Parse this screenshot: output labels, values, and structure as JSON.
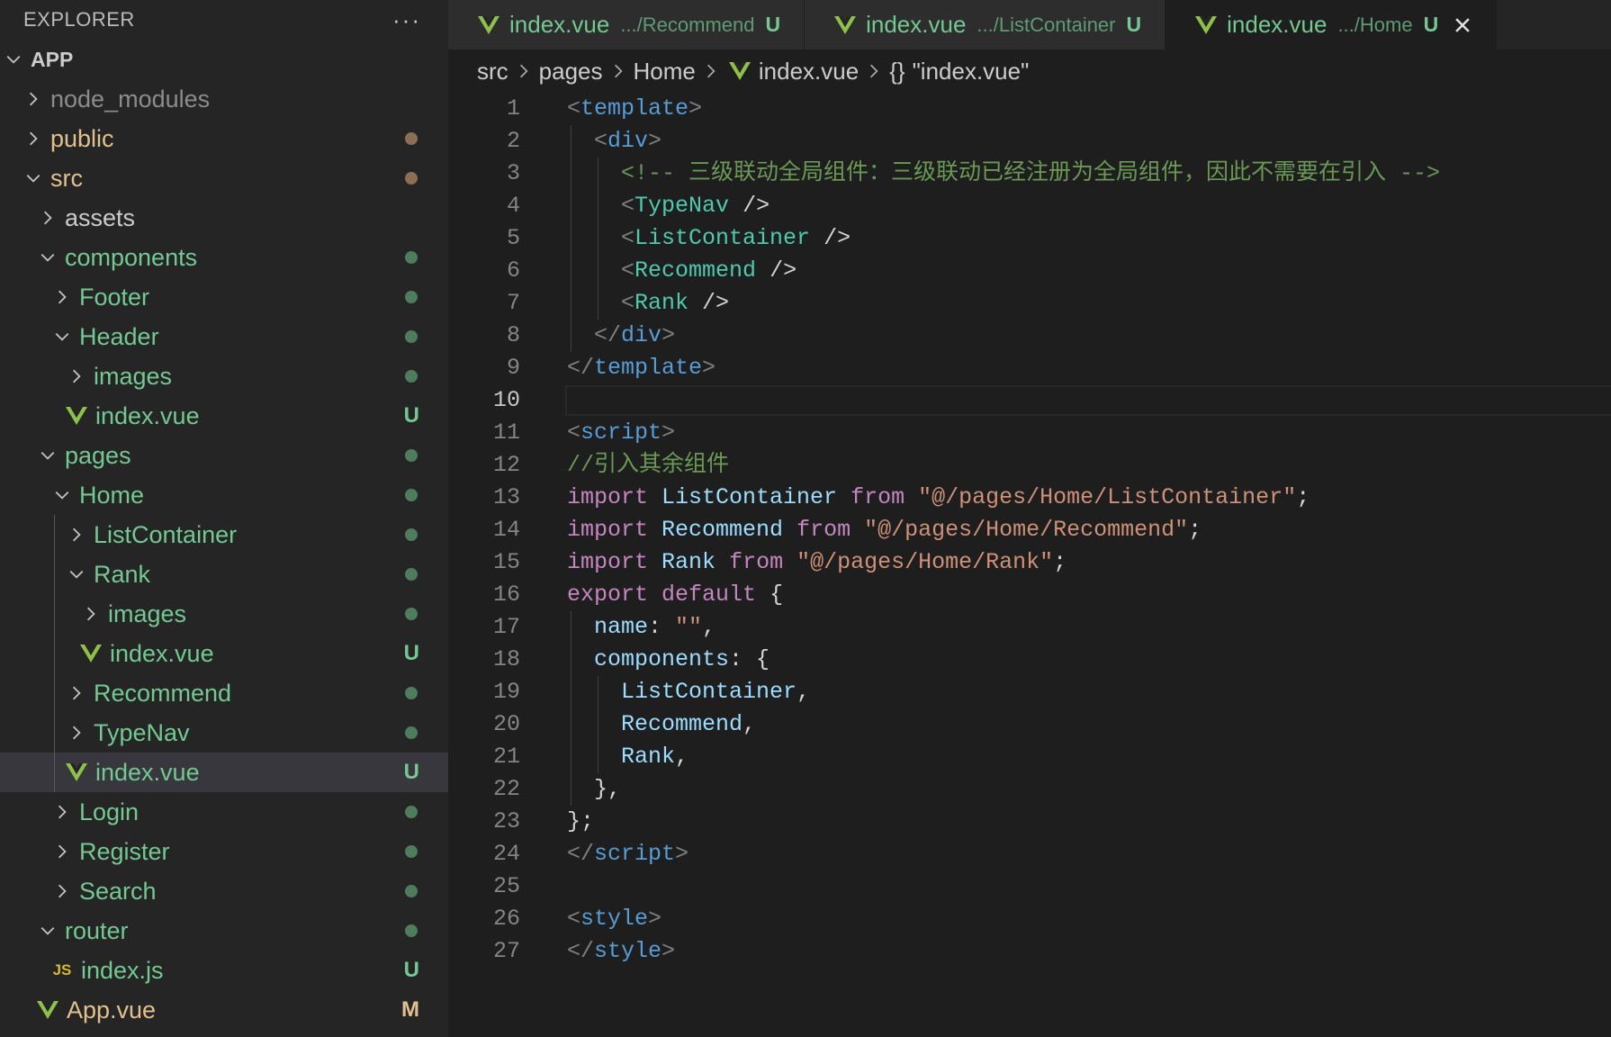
{
  "colors": {
    "untracked": "#73c991",
    "modified": "#e2c08d",
    "folder_untracked": "#73c991",
    "dot_brown": "#8a6f55",
    "vue_icon": "#8dc149"
  },
  "explorer": {
    "title": "EXPLORER",
    "more": "···",
    "tree": [
      {
        "label": "APP",
        "depth": 0,
        "type": "root",
        "expanded": true,
        "color": "#cccccc",
        "bold": true
      },
      {
        "label": "node_modules",
        "depth": 1,
        "type": "folder",
        "expanded": false,
        "color": "#8c8c8c"
      },
      {
        "label": "public",
        "depth": 1,
        "type": "folder",
        "expanded": false,
        "color": "#e2c08d",
        "dot": "#8a6f55"
      },
      {
        "label": "src",
        "depth": 1,
        "type": "folder",
        "expanded": true,
        "color": "#e2c08d",
        "dot": "#8a6f55"
      },
      {
        "label": "assets",
        "depth": 2,
        "type": "folder",
        "expanded": false,
        "color": "#cccccc"
      },
      {
        "label": "components",
        "depth": 2,
        "type": "folder",
        "expanded": true,
        "color": "#73c991",
        "dot": "#4e7d5c"
      },
      {
        "label": "Footer",
        "depth": 3,
        "type": "folder",
        "expanded": false,
        "color": "#73c991",
        "dot": "#4e7d5c"
      },
      {
        "label": "Header",
        "depth": 3,
        "type": "folder",
        "expanded": true,
        "color": "#73c991",
        "dot": "#4e7d5c"
      },
      {
        "label": "images",
        "depth": 4,
        "type": "folder",
        "expanded": false,
        "color": "#73c991",
        "dot": "#4e7d5c"
      },
      {
        "label": "index.vue",
        "depth": 4,
        "type": "vue",
        "color": "#73c991",
        "badge": "U"
      },
      {
        "label": "pages",
        "depth": 2,
        "type": "folder",
        "expanded": true,
        "color": "#73c991",
        "dot": "#4e7d5c"
      },
      {
        "label": "Home",
        "depth": 3,
        "type": "folder",
        "expanded": true,
        "color": "#73c991",
        "dot": "#4e7d5c"
      },
      {
        "label": "ListContainer",
        "depth": 4,
        "type": "folder",
        "expanded": false,
        "color": "#73c991",
        "dot": "#4e7d5c"
      },
      {
        "label": "Rank",
        "depth": 4,
        "type": "folder",
        "expanded": true,
        "color": "#73c991",
        "dot": "#4e7d5c"
      },
      {
        "label": "images",
        "depth": 5,
        "type": "folder",
        "expanded": false,
        "color": "#73c991",
        "dot": "#4e7d5c"
      },
      {
        "label": "index.vue",
        "depth": 5,
        "type": "vue",
        "color": "#73c991",
        "badge": "U"
      },
      {
        "label": "Recommend",
        "depth": 4,
        "type": "folder",
        "expanded": false,
        "color": "#73c991",
        "dot": "#4e7d5c"
      },
      {
        "label": "TypeNav",
        "depth": 4,
        "type": "folder",
        "expanded": false,
        "color": "#73c991",
        "dot": "#4e7d5c"
      },
      {
        "label": "index.vue",
        "depth": 4,
        "type": "vue",
        "color": "#73c991",
        "badge": "U",
        "selected": true
      },
      {
        "label": "Login",
        "depth": 3,
        "type": "folder",
        "expanded": false,
        "color": "#73c991",
        "dot": "#4e7d5c"
      },
      {
        "label": "Register",
        "depth": 3,
        "type": "folder",
        "expanded": false,
        "color": "#73c991",
        "dot": "#4e7d5c"
      },
      {
        "label": "Search",
        "depth": 3,
        "type": "folder",
        "expanded": false,
        "color": "#73c991",
        "dot": "#4e7d5c"
      },
      {
        "label": "router",
        "depth": 2,
        "type": "folder",
        "expanded": true,
        "color": "#73c991",
        "dot": "#4e7d5c"
      },
      {
        "label": "index.js",
        "depth": 3,
        "type": "js",
        "color": "#73c991",
        "badge": "U"
      },
      {
        "label": "App.vue",
        "depth": 2,
        "type": "vue",
        "color": "#e2c08d",
        "badge": "M",
        "badge_color": "#e2c08d"
      }
    ]
  },
  "tabs": [
    {
      "name": "index.vue",
      "path": ".../Recommend",
      "badge": "U",
      "active": false
    },
    {
      "name": "index.vue",
      "path": ".../ListContainer",
      "badge": "U",
      "active": false
    },
    {
      "name": "index.vue",
      "path": ".../Home",
      "badge": "U",
      "active": true
    }
  ],
  "breadcrumb": {
    "items": [
      "src",
      "pages",
      "Home",
      "index.vue"
    ],
    "symbol_icon": "{}",
    "symbol": "\"index.vue\""
  },
  "editor": {
    "current_line": 10,
    "lines": [
      [
        [
          "p",
          "<"
        ],
        [
          "tag",
          "template"
        ],
        [
          "p",
          ">"
        ]
      ],
      [
        [
          "sp",
          "  "
        ],
        [
          "p",
          "<"
        ],
        [
          "tag",
          "div"
        ],
        [
          "p",
          ">"
        ]
      ],
      [
        [
          "sp",
          "    "
        ],
        [
          "c",
          "<!-- 三级联动全局组件：三级联动已经注册为全局组件，因此不需要在引入 -->"
        ]
      ],
      [
        [
          "sp",
          "    "
        ],
        [
          "p",
          "<"
        ],
        [
          "comp",
          "TypeNav"
        ],
        [
          "t",
          " />"
        ]
      ],
      [
        [
          "sp",
          "    "
        ],
        [
          "p",
          "<"
        ],
        [
          "comp",
          "ListContainer"
        ],
        [
          "t",
          " />"
        ]
      ],
      [
        [
          "sp",
          "    "
        ],
        [
          "p",
          "<"
        ],
        [
          "comp",
          "Recommend"
        ],
        [
          "t",
          " />"
        ]
      ],
      [
        [
          "sp",
          "    "
        ],
        [
          "p",
          "<"
        ],
        [
          "comp",
          "Rank"
        ],
        [
          "t",
          " />"
        ]
      ],
      [
        [
          "sp",
          "  "
        ],
        [
          "p",
          "</"
        ],
        [
          "tag",
          "div"
        ],
        [
          "p",
          ">"
        ]
      ],
      [
        [
          "p",
          "</"
        ],
        [
          "tag",
          "template"
        ],
        [
          "p",
          ">"
        ]
      ],
      [],
      [
        [
          "p",
          "<"
        ],
        [
          "tag",
          "script"
        ],
        [
          "p",
          ">"
        ]
      ],
      [
        [
          "c",
          "//引入其余组件"
        ]
      ],
      [
        [
          "kw",
          "import"
        ],
        [
          "t",
          " "
        ],
        [
          "var",
          "ListContainer"
        ],
        [
          "t",
          " "
        ],
        [
          "kw",
          "from"
        ],
        [
          "t",
          " "
        ],
        [
          "str",
          "\"@/pages/Home/ListContainer\""
        ],
        [
          "t",
          ";"
        ]
      ],
      [
        [
          "kw",
          "import"
        ],
        [
          "t",
          " "
        ],
        [
          "var",
          "Recommend"
        ],
        [
          "t",
          " "
        ],
        [
          "kw",
          "from"
        ],
        [
          "t",
          " "
        ],
        [
          "str",
          "\"@/pages/Home/Recommend\""
        ],
        [
          "t",
          ";"
        ]
      ],
      [
        [
          "kw",
          "import"
        ],
        [
          "t",
          " "
        ],
        [
          "var",
          "Rank"
        ],
        [
          "t",
          " "
        ],
        [
          "kw",
          "from"
        ],
        [
          "t",
          " "
        ],
        [
          "str",
          "\"@/pages/Home/Rank\""
        ],
        [
          "t",
          ";"
        ]
      ],
      [
        [
          "kw",
          "export"
        ],
        [
          "t",
          " "
        ],
        [
          "kw",
          "default"
        ],
        [
          "t",
          " {"
        ]
      ],
      [
        [
          "sp",
          "  "
        ],
        [
          "var",
          "name"
        ],
        [
          "t",
          ": "
        ],
        [
          "str",
          "\"\""
        ],
        [
          "t",
          ","
        ]
      ],
      [
        [
          "sp",
          "  "
        ],
        [
          "var",
          "components"
        ],
        [
          "t",
          ": {"
        ]
      ],
      [
        [
          "sp",
          "    "
        ],
        [
          "var",
          "ListContainer"
        ],
        [
          "t",
          ","
        ]
      ],
      [
        [
          "sp",
          "    "
        ],
        [
          "var",
          "Recommend"
        ],
        [
          "t",
          ","
        ]
      ],
      [
        [
          "sp",
          "    "
        ],
        [
          "var",
          "Rank"
        ],
        [
          "t",
          ","
        ]
      ],
      [
        [
          "sp",
          "  "
        ],
        [
          "t",
          "},"
        ]
      ],
      [
        [
          "t",
          "};"
        ]
      ],
      [
        [
          "p",
          "</"
        ],
        [
          "tag",
          "script"
        ],
        [
          "p",
          ">"
        ]
      ],
      [],
      [
        [
          "p",
          "<"
        ],
        [
          "tag",
          "style"
        ],
        [
          "p",
          ">"
        ]
      ],
      [
        [
          "p",
          "</"
        ],
        [
          "tag",
          "style"
        ],
        [
          "p",
          ">"
        ]
      ]
    ]
  }
}
